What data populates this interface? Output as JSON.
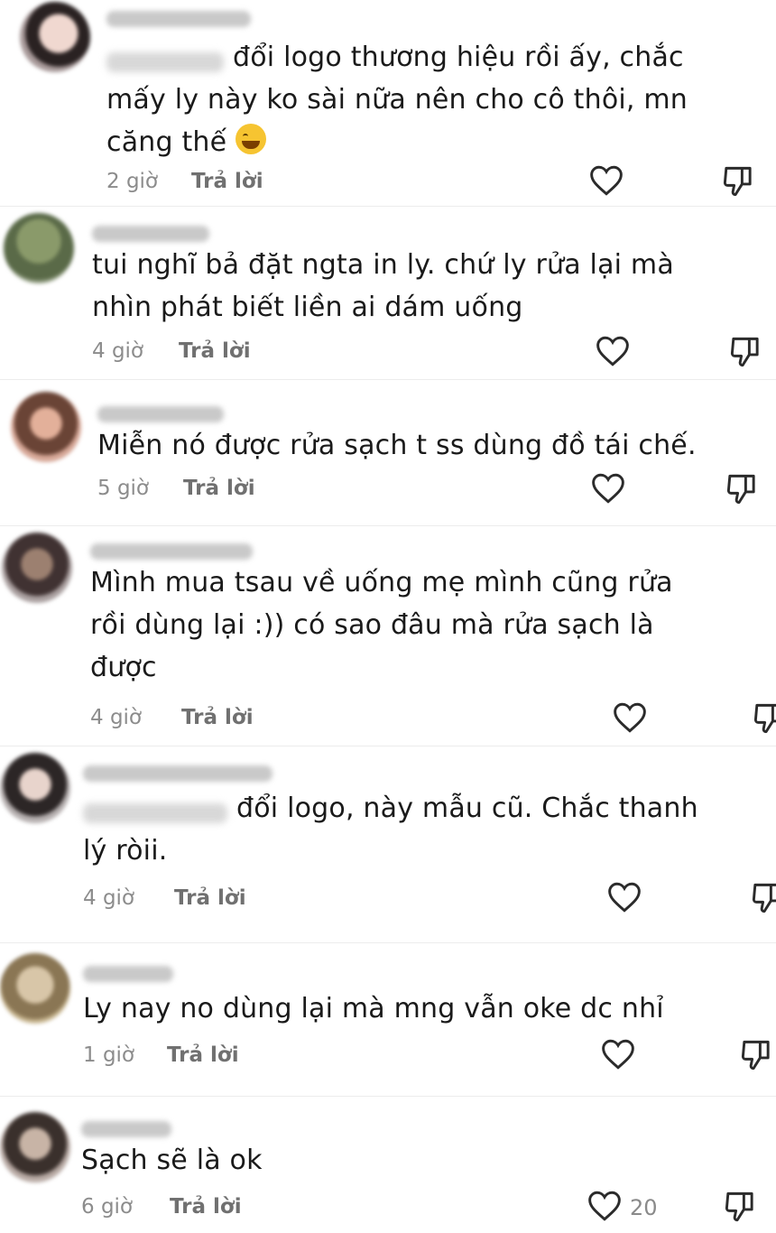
{
  "comments": [
    {
      "text": "đổi logo thương hiệu rồi ấy, chắc\nmấy ly này ko sài nữa nên cho cô thôi, mn\ncăng thế",
      "time": "2 giờ",
      "reply": "Trả lời",
      "has_emoji": true
    },
    {
      "text": "tui nghĩ bả đặt ngta in ly. chứ ly rửa lại mà\nnhìn phát biết liền ai dám uống",
      "time": "4 giờ",
      "reply": "Trả lời"
    },
    {
      "text": "Miễn nó được rửa sạch t ss dùng đồ tái chế.",
      "time": "5 giờ",
      "reply": "Trả lời"
    },
    {
      "text": "Mình mua tsau về uống mẹ mình cũng rửa\nrồi dùng lại :)) có sao đâu mà rửa sạch là\nđược",
      "time": "4 giờ",
      "reply": "Trả lời"
    },
    {
      "text": "đổi logo, này mẫu cũ. Chắc thanh\nlý ròii.",
      "time": "4 giờ",
      "reply": "Trả lời"
    },
    {
      "text": "Ly nay no dùng lại mà mng vẫn oke dc nhỉ",
      "time": "1 giờ",
      "reply": "Trả lời"
    },
    {
      "text": "Sạch sẽ là ok",
      "time": "6 giờ",
      "reply": "Trả lời",
      "likes": "20"
    }
  ],
  "colors": {
    "text": "#1a1a1a",
    "meta": "#8c8c8c",
    "reply": "#707070",
    "icon": "#2b2b2b"
  }
}
